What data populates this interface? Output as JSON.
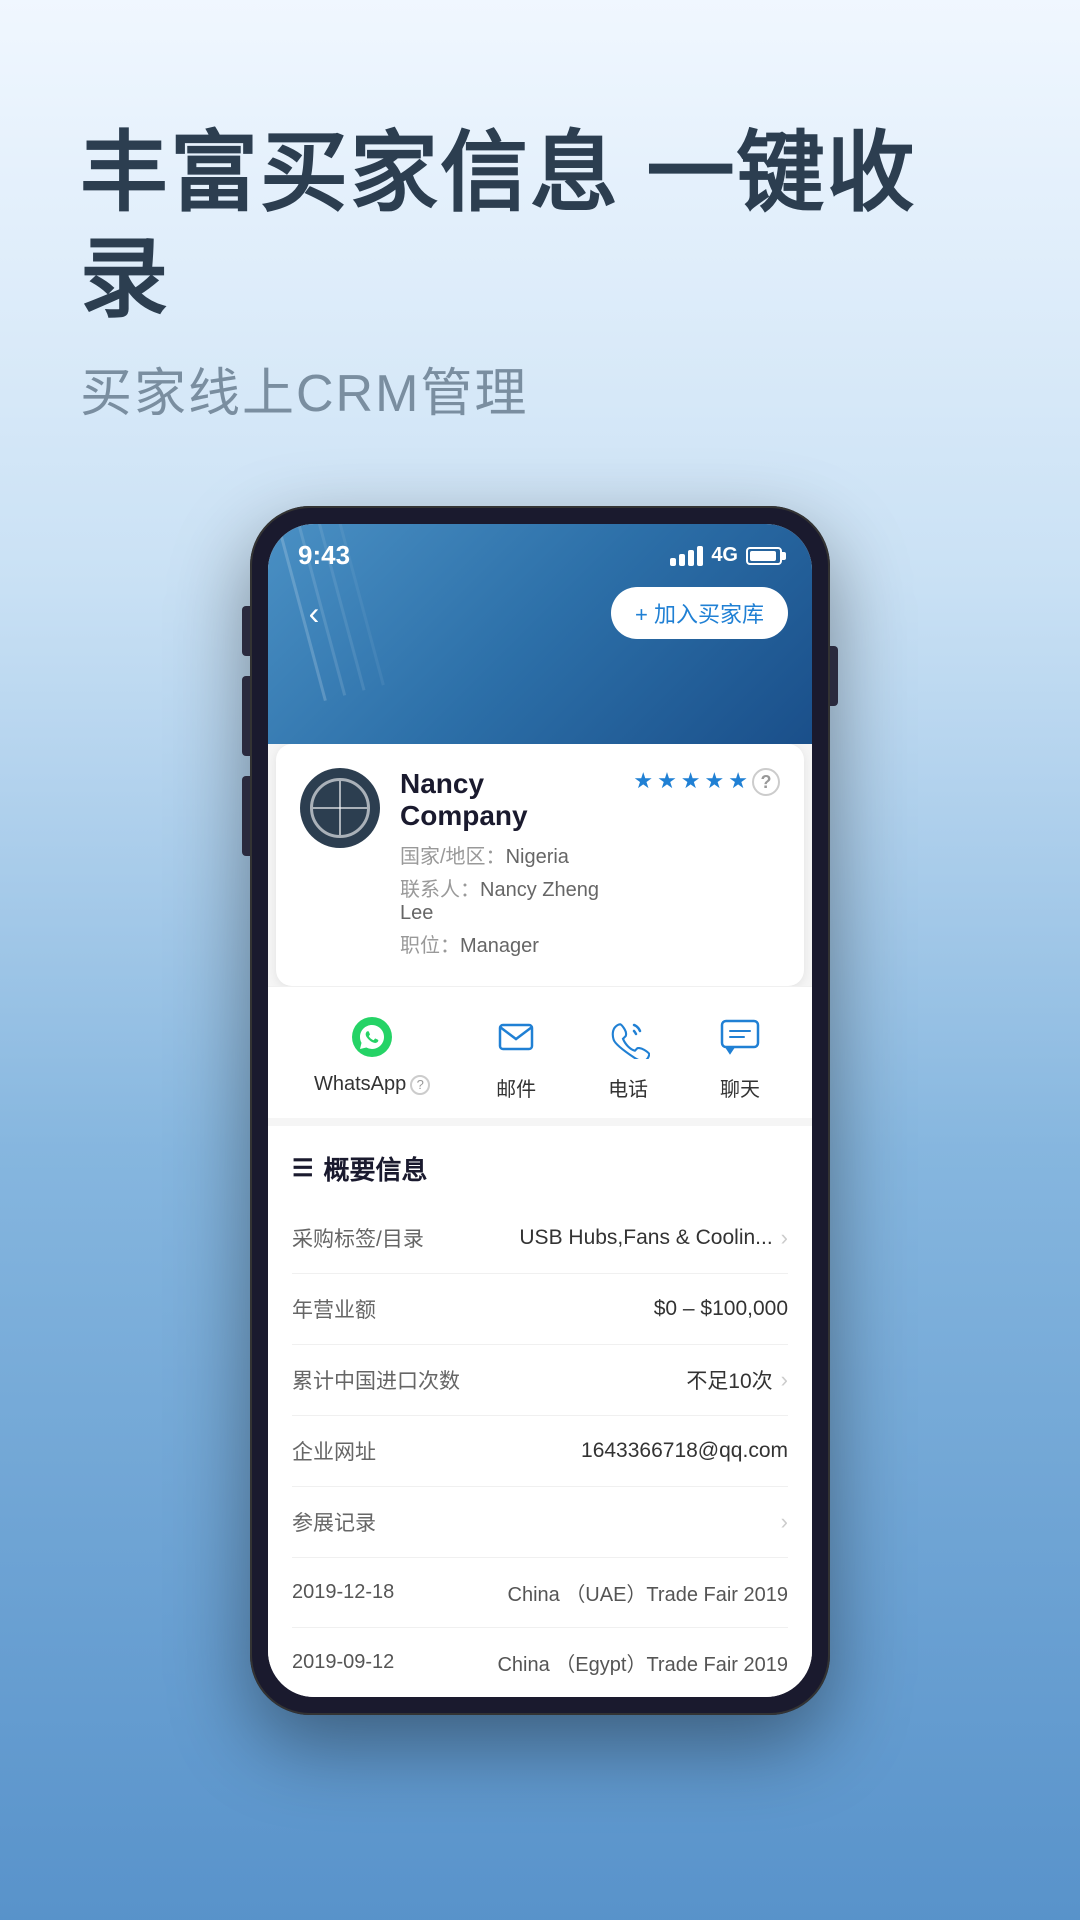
{
  "page": {
    "background": {
      "gradient_start": "#f0f4fa",
      "gradient_end": "#7aadd4"
    }
  },
  "header": {
    "main_title": "丰富买家信息 一键收录",
    "sub_title": "买家线上CRM管理"
  },
  "phone": {
    "status_bar": {
      "time": "9:43",
      "signal": "4G"
    },
    "nav": {
      "back_label": "‹",
      "add_button_label": "+ 加入买家库"
    },
    "contact": {
      "company_name": "Nancy Company",
      "country_label": "国家/地区：",
      "country": "Nigeria",
      "contact_label": "联系人：",
      "contact_name": "Nancy Zheng Lee",
      "position_label": "职位：",
      "position": "Manager",
      "stars": 5,
      "star_half": false
    },
    "actions": [
      {
        "id": "whatsapp",
        "label": "WhatsApp",
        "has_help": true
      },
      {
        "id": "email",
        "label": "邮件",
        "has_help": false
      },
      {
        "id": "phone",
        "label": "电话",
        "has_help": false
      },
      {
        "id": "chat",
        "label": "聊天",
        "has_help": false
      }
    ],
    "overview": {
      "title": "概要信息",
      "rows": [
        {
          "label": "采购标签/目录",
          "value": "USB Hubs,Fans & Coolin...",
          "has_arrow": true
        },
        {
          "label": "年营业额",
          "value": "$0 – $100,000",
          "has_arrow": false
        },
        {
          "label": "累计中国进口次数",
          "value": "不足10次",
          "has_arrow": true
        },
        {
          "label": "企业网址",
          "value": "1643366718@qq.com",
          "has_arrow": false
        },
        {
          "label": "参展记录",
          "value": "",
          "has_arrow": true
        }
      ],
      "trade_records": [
        {
          "date": "2019-12-18",
          "event": "China （UAE）Trade Fair 2019"
        },
        {
          "date": "2019-09-12",
          "event": "China （Egypt）Trade Fair 2019"
        }
      ]
    }
  }
}
